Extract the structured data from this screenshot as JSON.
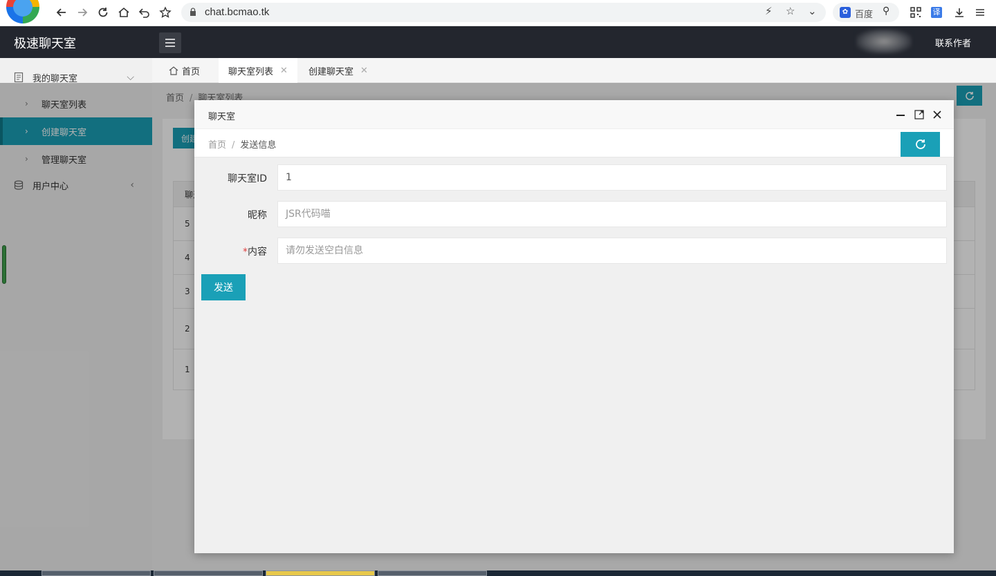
{
  "browser": {
    "url": "chat.bcmao.tk",
    "search_engine_label": "百度",
    "translate_label": "译"
  },
  "app": {
    "title": "极速聊天室",
    "contact_label": "联系作者"
  },
  "sidebar": {
    "groups": [
      {
        "label": "我的聊天室",
        "icon": "document-icon"
      },
      {
        "label": "用户中心",
        "icon": "database-icon"
      }
    ],
    "subitems": [
      {
        "label": "聊天室列表"
      },
      {
        "label": "创建聊天室"
      },
      {
        "label": "管理聊天室"
      }
    ]
  },
  "tabs": [
    {
      "label": "首页",
      "icon": "home-icon"
    },
    {
      "label": "聊天室列表",
      "close": "✕"
    },
    {
      "label": "创建聊天室",
      "close": "✕"
    }
  ],
  "main": {
    "breadcrumb": [
      "首页",
      "聊天室列表"
    ],
    "create_button": "创建",
    "table_header": "聊天",
    "rows": [
      "5",
      "4",
      "3",
      "2",
      "1"
    ]
  },
  "modal": {
    "title": "聊天室",
    "breadcrumb_home": "首页",
    "breadcrumb_current": "发送信息",
    "fields": [
      {
        "label": "聊天室ID",
        "value": "1",
        "required": false
      },
      {
        "label": "昵称",
        "placeholder": "JSR代码喵",
        "required": false
      },
      {
        "label": "内容",
        "placeholder": "请勿发送空白信息",
        "required": true,
        "required_mark": "*"
      }
    ],
    "send_button": "发送"
  },
  "colors": {
    "accent": "#1aa0b7",
    "header_bg": "#23262e"
  }
}
